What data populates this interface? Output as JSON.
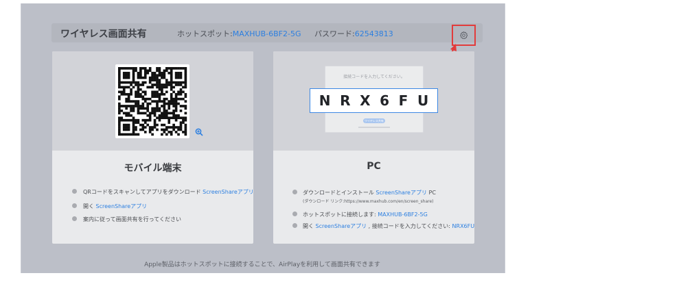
{
  "header": {
    "title": "ワイヤレス画面共有",
    "hotspot_label": "ホットスポット:",
    "hotspot_value": "MAXHUB-6BF2-5G",
    "password_label": "パスワード:",
    "password_value": "62543813"
  },
  "icons": {
    "settings": "gear-icon",
    "zoom": "zoom-in-icon",
    "annotation": "red-arrow"
  },
  "mobile": {
    "title": "モバイル端末",
    "steps": [
      {
        "text": "QRコードをスキャンしてアプリをダウンロード ",
        "link": "ScreenShareアプリ"
      },
      {
        "text": "開く ",
        "link": "ScreenShareアプリ"
      },
      {
        "text": "案内に従って画面共有を行ってください",
        "link": ""
      }
    ]
  },
  "pc": {
    "title": "PC",
    "mock_title": "接続コードを入力してください。",
    "mock_button": "ワイヤレス共有",
    "code": [
      "N",
      "R",
      "X",
      "6",
      "F",
      "U"
    ],
    "step1_text": "ダウンロードとインストール ",
    "step1_link": "ScreenShareアプリ",
    "step1_suffix": " PC",
    "step1_sub": "(ダウンロード リンク:https://www.maxhub.com/en/screen_share)",
    "step2_text": "ホットスポットに接続します: ",
    "step2_link": "MAXHUB-6BF2-5G",
    "step3_text": "開く ",
    "step3_link": "ScreenShareアプリ",
    "step3_mid": " , 接続コードを入力してください: ",
    "step3_code": "NRX6FU"
  },
  "footer": {
    "text": "Apple製品はホットスポットに接続することで、AirPlayを利用して画面共有できます"
  },
  "colors": {
    "accent": "#2c7fe0",
    "highlight": "#e23b3b",
    "background": "#bcbfc8"
  }
}
